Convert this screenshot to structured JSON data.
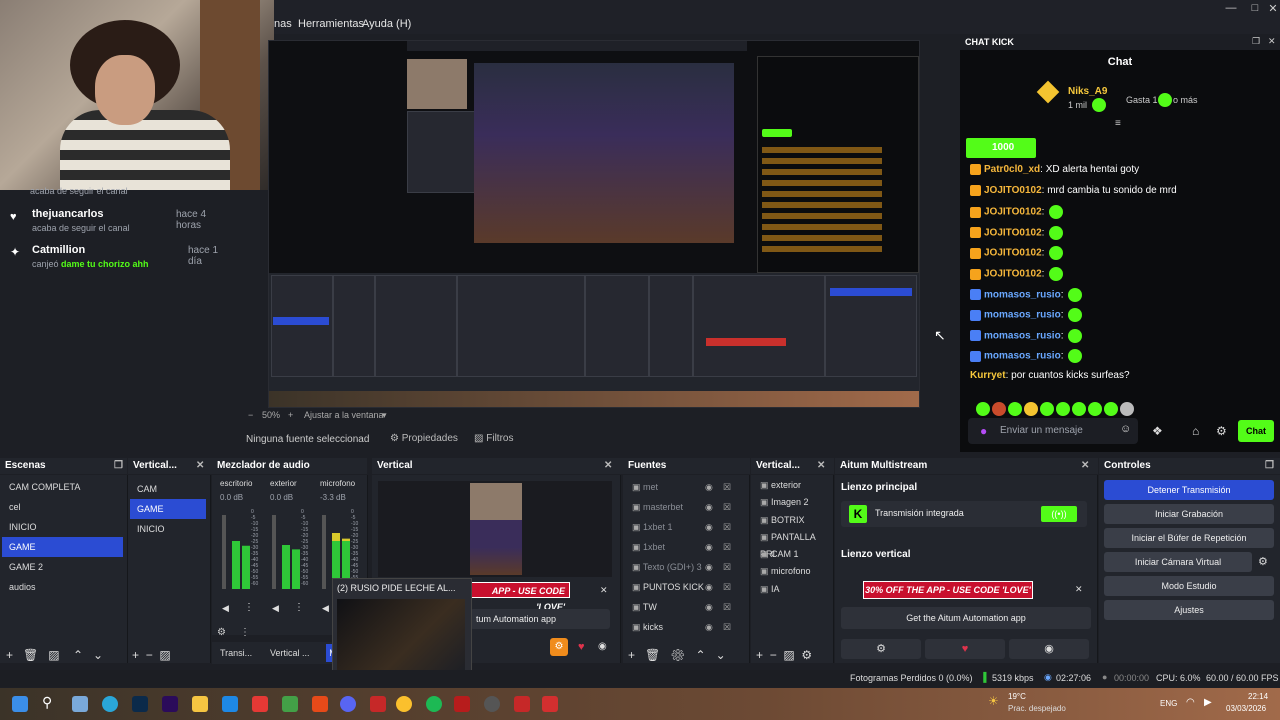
{
  "menubar": {
    "items": [
      "nas",
      "Herramientas",
      "Ayuda (H)"
    ]
  },
  "activity": [
    {
      "name": "thejuancarlos",
      "time": "hace 4 horas",
      "sub": "acaba de seguir el canal",
      "sub_green": ""
    },
    {
      "name": "Catmillion",
      "time": "hace 1 día",
      "sub": "canjeó",
      "sub_green": "dame tu chorizo ahh"
    }
  ],
  "activity_cut": "acaba de seguir el canal",
  "preview": {
    "zoom": "50%",
    "fit": "Ajustar a la ventana"
  },
  "source_toolbar": {
    "none_selected": "Ninguna fuente seleccionad",
    "properties": "Propiedades",
    "filters": "Filtros"
  },
  "chat": {
    "panel_title": "CHAT KICK",
    "title": "Chat",
    "gifter": {
      "name": "Niks_A9",
      "amount": "1 mil",
      "spend": "Gasta 1",
      "or_more": "o más"
    },
    "pinned_amount": "1000",
    "messages": [
      {
        "user": "Patr0cl0_xd",
        "text": "XD alerta hentai goty",
        "badge": "yellow"
      },
      {
        "user": "JOJITO0102",
        "text": "mrd cambia tu sonido de mrd",
        "badge": "yellow"
      },
      {
        "user": "JOJITO0102",
        "text": "",
        "badge": "yellow"
      },
      {
        "user": "JOJITO0102",
        "text": "",
        "badge": "yellow"
      },
      {
        "user": "JOJITO0102",
        "text": "",
        "badge": "yellow"
      },
      {
        "user": "JOJITO0102",
        "text": "",
        "badge": "yellow"
      },
      {
        "user": "momasos_rusio",
        "text": "",
        "badge": "blue"
      },
      {
        "user": "momasos_rusio",
        "text": "",
        "badge": "blue"
      },
      {
        "user": "momasos_rusio",
        "text": "",
        "badge": "blue"
      },
      {
        "user": "momasos_rusio",
        "text": "",
        "badge": "blue"
      },
      {
        "user": "Kurryet",
        "text": "por cuantos kicks surfeas?",
        "badge": ""
      }
    ],
    "input_placeholder": "Enviar un mensaje",
    "send_label": "Chat"
  },
  "docks": {
    "escenas": {
      "title": "Escenas",
      "items": [
        "CAM COMPLETA",
        "cel",
        "INICIO",
        "GAME",
        "GAME 2",
        "audios"
      ],
      "selected": 3
    },
    "vertical1": {
      "title": "Vertical...",
      "items": [
        "CAM",
        "GAME",
        "INICIO"
      ],
      "selected": 1
    },
    "mixer": {
      "title": "Mezclador de audio",
      "channels": [
        {
          "name": "escritorio",
          "db": "0.0 dB",
          "level": 0.6
        },
        {
          "name": "exterior",
          "db": "0.0 dB",
          "level": 0.55
        },
        {
          "name": "microfono",
          "db": "-3.3 dB",
          "level": 0.7
        }
      ],
      "scale": [
        "0",
        "-5",
        "-10",
        "-15",
        "-20",
        "-25",
        "-30",
        "-35",
        "-40",
        "-45",
        "-50",
        "-55",
        "-60"
      ]
    },
    "vertical_preview": {
      "title": "Vertical",
      "promo": "30% OFF THE APP - USE CODE 'LOVE'",
      "promo_cut": "APP - USE CODE 'LOVE'",
      "automation": "tum Automation app"
    },
    "popup": {
      "title": "(2) RUSIO PIDE LECHE AL..."
    },
    "fuentes": {
      "title": "Fuentes",
      "items": [
        "met",
        "masterbet",
        "1xbet 1",
        "1xbet",
        "Texto (GDI+) 3",
        "PUNTOS KICK",
        "TW",
        "kicks"
      ]
    },
    "vertical2": {
      "title": "Vertical...",
      "items": [
        "exterior",
        "Imagen 2",
        "BOTRIX",
        "PANTALLA PRI",
        "CAM 1",
        "microfono",
        "IA"
      ]
    },
    "aitum": {
      "title": "Aitum Multistream",
      "main_label": "Lienzo principal",
      "integrated": "Transmisión integrada",
      "vertical_label": "Lienzo vertical",
      "promo": "30% OFF THE APP - USE CODE 'LOVE'",
      "get_app": "Get the Aitum Automation app"
    },
    "controles": {
      "title": "Controles",
      "buttons": [
        "Detener Transmisión",
        "Iniciar Grabación",
        "Iniciar el Búfer de Repetición",
        "Iniciar Cámara Virtual",
        "Modo Estudio",
        "Ajustes"
      ]
    },
    "bottom_tabs": [
      "Transi...",
      "Vertical ..."
    ]
  },
  "status": {
    "dropped": "Fotogramas Perdidos 0 (0.0%)",
    "kbps": "5319 kbps",
    "live_time": "02:27:06",
    "rec_time": "00:00:00",
    "cpu": "CPU: 6.0%",
    "fps": "60.00 / 60.00 FPS"
  },
  "taskbar": {
    "weather_temp": "19°C",
    "weather_desc": "Prac. despejado",
    "lang": "ENG",
    "time": "22:14",
    "date": "03/03/2026"
  }
}
